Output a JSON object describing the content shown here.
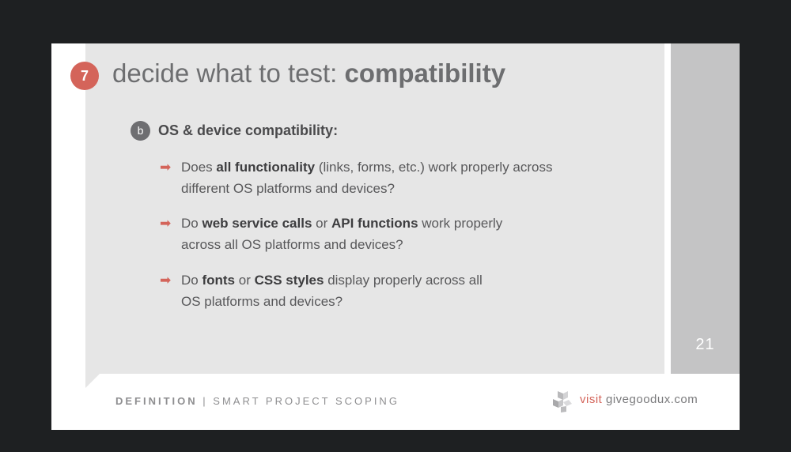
{
  "slide": {
    "step_number": "7",
    "title_prefix": "decide what to test: ",
    "title_bold": "compatibility",
    "section_letter": "b",
    "section_heading": "OS & device compatibility:",
    "bullets": [
      {
        "parts": [
          "Does ",
          "all functionality",
          " (links, forms, etc.) work properly across",
          "different OS platforms and devices?"
        ]
      },
      {
        "parts": [
          "Do ",
          "web service calls",
          " or ",
          "API functions",
          " work properly",
          "across all OS platforms and devices?"
        ]
      },
      {
        "parts": [
          "Do ",
          "fonts",
          " or ",
          "CSS styles",
          " display properly across all",
          "OS platforms and devices?"
        ]
      }
    ],
    "bullet_marker": "➡",
    "page_number": "21"
  },
  "footer": {
    "label": "DEFINITION",
    "separator": " | ",
    "subtitle": "SMART PROJECT SCOPING",
    "visit": "visit",
    "site": " givegoodux.com",
    "logo_icon": "cube-cluster-icon"
  },
  "colors": {
    "accent": "#d4645a",
    "panel": "#e6e6e6",
    "sidebar": "#c4c4c5",
    "background": "#1e2022"
  }
}
